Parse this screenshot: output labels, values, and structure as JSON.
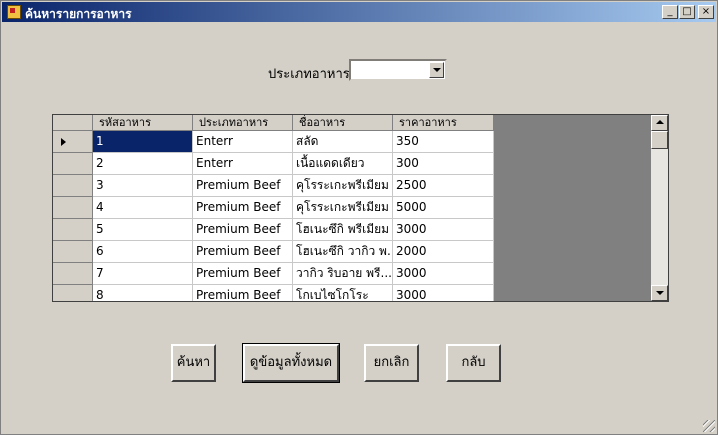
{
  "window": {
    "title": "ค้นหารายการอาหาร",
    "controls": {
      "minimize": "_",
      "maximize": "□",
      "close": "×"
    }
  },
  "filter": {
    "label": "ประเภทอาหาร",
    "selected_value": ""
  },
  "grid": {
    "columns": [
      "รหัสอาหาร",
      "ประเภทอาหาร",
      "ชื่ออาหาร",
      "ราคาอาหาร"
    ],
    "rows": [
      [
        "1",
        "Enterr",
        "สลัด",
        "350"
      ],
      [
        "2",
        "Enterr",
        "เนื้อแดดเดียว",
        "300"
      ],
      [
        "3",
        "Premium Beef",
        "คุโรระเกะพรีเมียม",
        "2500"
      ],
      [
        "4",
        "Premium Beef",
        "คุโรระเกะพรีเมียม L",
        "5000"
      ],
      [
        "5",
        "Premium Beef",
        "โฮเนะซึกิ พรีเมียม",
        "3000"
      ],
      [
        "6",
        "Premium Beef",
        "โฮเนะซึกิ วากิว พ...",
        "2000"
      ],
      [
        "7",
        "Premium Beef",
        "วากิว ริบอาย พรี...",
        "3000"
      ],
      [
        "8",
        "Premium Beef",
        "โกเบไซโกโระ",
        "3000"
      ]
    ],
    "selected_row": 0
  },
  "buttons": {
    "search": "ค้นหา",
    "view_all": "ดูข้อมูลทั้งหมด",
    "cancel": "ยกเลิก",
    "back": "กลับ"
  },
  "colors": {
    "titlebar_start": "#0a246a",
    "titlebar_end": "#a6caf0",
    "selection": "#0a246a",
    "face": "#d4d0c8"
  }
}
